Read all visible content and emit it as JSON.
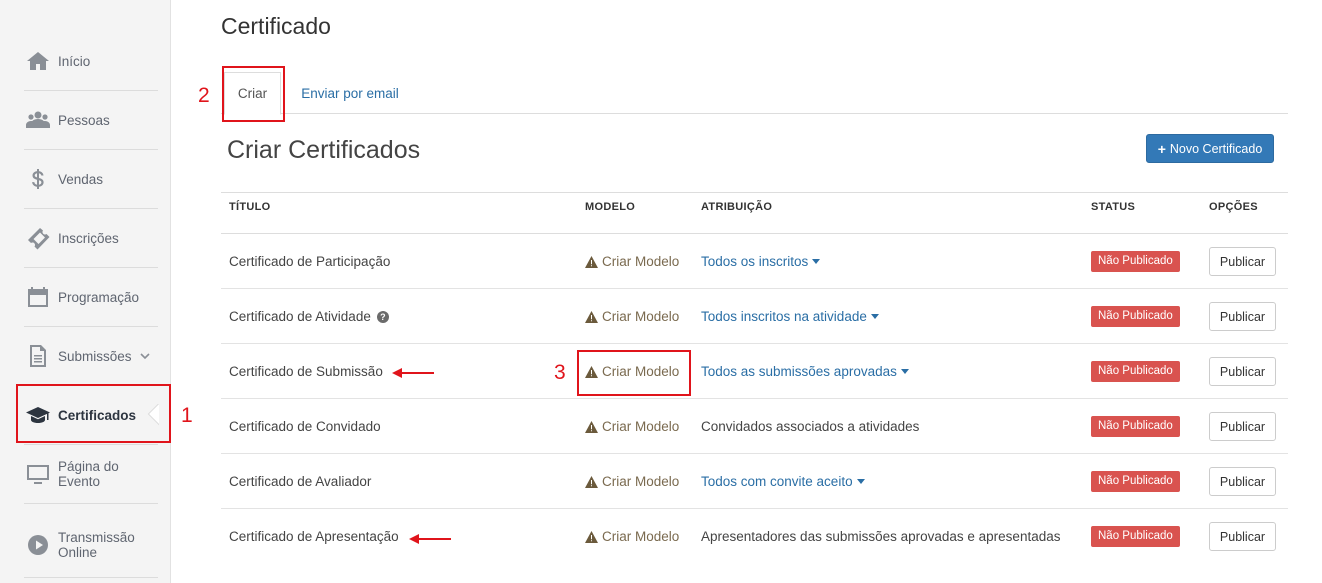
{
  "sidebar": {
    "items": [
      {
        "label": "Início",
        "icon": "home-icon"
      },
      {
        "label": "Pessoas",
        "icon": "people-icon"
      },
      {
        "label": "Vendas",
        "icon": "dollar-icon"
      },
      {
        "label": "Inscrições",
        "icon": "ticket-icon"
      },
      {
        "label": "Programação",
        "icon": "calendar-icon"
      },
      {
        "label": "Submissões",
        "icon": "document-icon"
      },
      {
        "label": "Certificados",
        "icon": "graduation-cap-icon"
      },
      {
        "label": "Página do Evento",
        "icon": "monitor-icon"
      },
      {
        "label": "Transmissão Online",
        "icon": "play-icon"
      }
    ],
    "active": "Certificados"
  },
  "page": {
    "title": "Certificado"
  },
  "tabs": [
    {
      "label": "Criar",
      "active": true
    },
    {
      "label": "Enviar por email",
      "active": false
    }
  ],
  "section": {
    "title": "Criar Certificados",
    "new_button": "Novo Certificado"
  },
  "table": {
    "headers": {
      "title": "TÍTULO",
      "model": "MODELO",
      "attr": "ATRIBUIÇÃO",
      "status": "STATUS",
      "options": "OPÇÕES"
    },
    "rows": [
      {
        "title": "Certificado de Participação",
        "model": "Criar Modelo",
        "attribution": "Todos os inscritos",
        "status": "Não Publicado",
        "action": "Publicar"
      },
      {
        "title": "Certificado de Atividade",
        "model": "Criar Modelo",
        "attribution": "Todos inscritos na atividade",
        "status": "Não Publicado",
        "action": "Publicar"
      },
      {
        "title": "Certificado de Submissão",
        "model": "Criar Modelo",
        "attribution": "Todos as submissões aprovadas",
        "status": "Não Publicado",
        "action": "Publicar"
      },
      {
        "title": "Certificado de Convidado",
        "model": "Criar Modelo",
        "attribution": "Convidados associados a atividades",
        "status": "Não Publicado",
        "action": "Publicar"
      },
      {
        "title": "Certificado de Avaliador",
        "model": "Criar Modelo",
        "attribution": "Todos com convite aceito",
        "status": "Não Publicado",
        "action": "Publicar"
      },
      {
        "title": "Certificado de Apresentação",
        "model": "Criar Modelo",
        "attribution": "Apresentadores das submissões aprovadas e apresentadas",
        "status": "Não Publicado",
        "action": "Publicar"
      }
    ]
  },
  "annotations": {
    "n1": "1",
    "n2": "2",
    "n3": "3",
    "color": "#e0141b"
  },
  "colors": {
    "link": "#2a6ea5",
    "primary": "#3379b7",
    "danger": "#d9534f",
    "annotation": "#e0141b"
  }
}
